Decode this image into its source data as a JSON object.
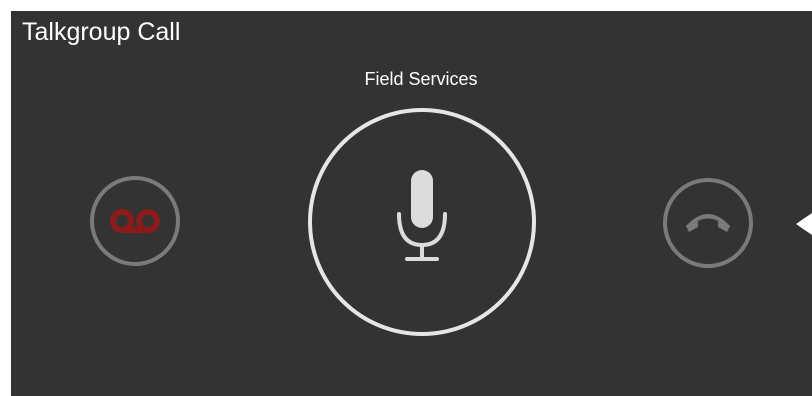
{
  "window": {
    "title": "Talkgroup Call"
  },
  "call": {
    "talkgroup_name": "Field Services"
  },
  "controls": {
    "voicemail_icon": "voicemail-icon",
    "ptt_icon": "microphone-icon",
    "hangup_icon": "hang-up-phone-icon"
  },
  "colors": {
    "panel_background": "#333333",
    "voicemail_red": "#8b1a1a",
    "button_ring": "#7a7a7a",
    "ptt_ring": "#e6e6e6",
    "icon_gray": "#dcdcdc"
  }
}
